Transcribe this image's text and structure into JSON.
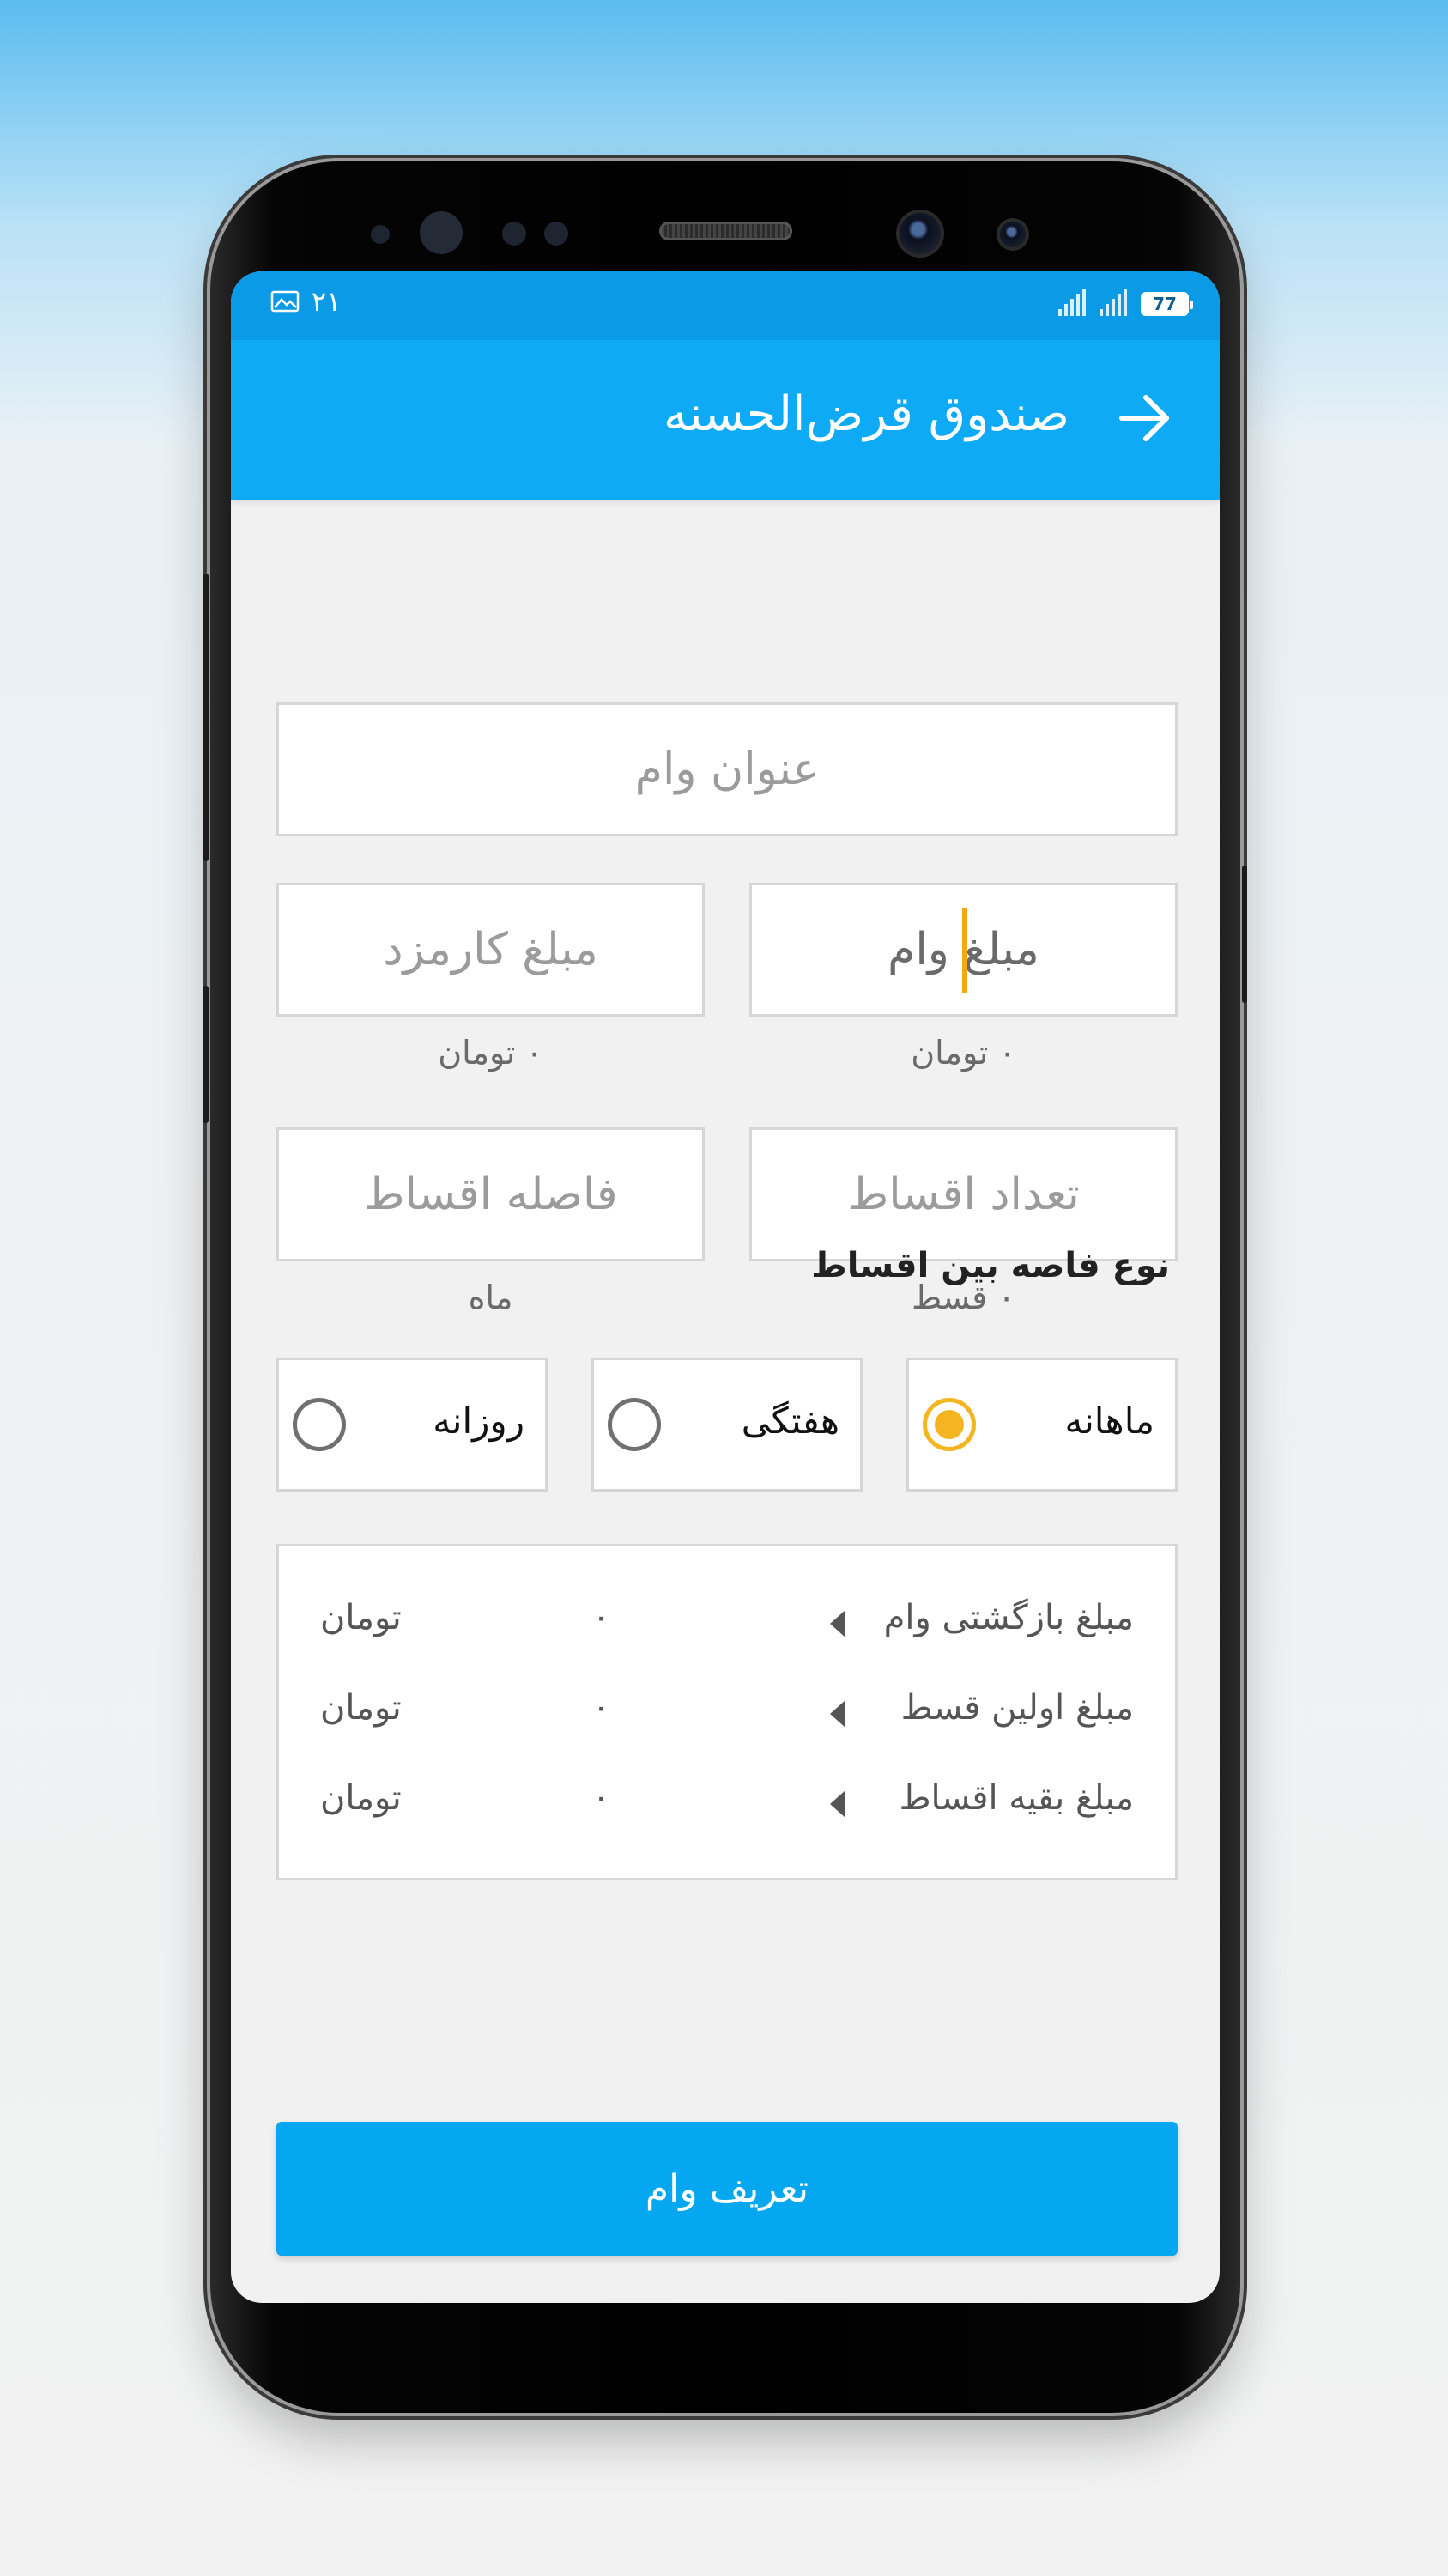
{
  "status_bar": {
    "time": "۲۱",
    "battery": "77"
  },
  "app_bar": {
    "title": "صندوق قرض‌الحسنه"
  },
  "form": {
    "loan_title_placeholder": "عنوان وام",
    "loan_amount_placeholder": "مبلغ وام",
    "loan_amount_unit": "۰ تومان",
    "fee_amount_placeholder": "مبلغ کارمزد",
    "fee_amount_unit": "۰ تومان",
    "installments_count_placeholder": "تعداد اقساط",
    "installments_count_unit": "۰ قسط",
    "installment_interval_placeholder": "فاصله اقساط",
    "installment_interval_unit": "ماه"
  },
  "interval_type": {
    "title": "نوع فاصه بین اقساط",
    "options": [
      {
        "label": "ماهانه",
        "selected": true
      },
      {
        "label": "هفتگی",
        "selected": false
      },
      {
        "label": "روزانه",
        "selected": false
      }
    ]
  },
  "summary": {
    "rows": [
      {
        "label": "مبلغ بازگشتی وام",
        "value": "۰",
        "unit": "تومان"
      },
      {
        "label": "مبلغ اولین قسط",
        "value": "۰",
        "unit": "تومان"
      },
      {
        "label": "مبلغ بقیه اقساط",
        "value": "۰",
        "unit": "تومان"
      }
    ]
  },
  "submit_button": {
    "label": "تعریف وام"
  },
  "colors": {
    "primary": "#0eaaf5",
    "status_bar": "#0b9ae6",
    "accent": "#f4b521",
    "button": "#05a7f1"
  }
}
